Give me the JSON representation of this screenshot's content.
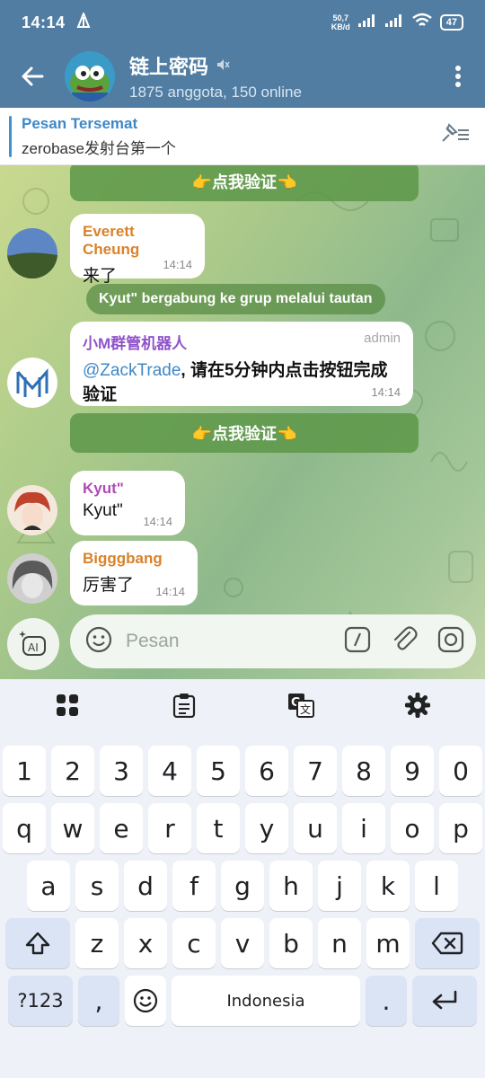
{
  "status_bar": {
    "time": "14:14",
    "net_speed": "50,7",
    "net_unit": "KB/d",
    "battery": "47"
  },
  "header": {
    "title": "链上密码",
    "subtitle": "1875 anggota, 150 online"
  },
  "pinned": {
    "title": "Pesan Tersemat",
    "text": "zerobase发射台第一个"
  },
  "messages": [
    {
      "type": "button",
      "text": "👉点我验证👈"
    },
    {
      "type": "message",
      "sender": "Everett Cheung",
      "sender_color": "#d9822b",
      "text": "来了",
      "time": "14:14"
    },
    {
      "type": "service",
      "text": "Kyut\" bergabung ke grup melalui tautan"
    },
    {
      "type": "message",
      "sender": "小M群管机器人",
      "sender_color": "#8f54c9",
      "badge": "admin",
      "mention": "@ZackTrade",
      "text": ", 请在5分钟内点击按钮完成验证",
      "time": "14:14"
    },
    {
      "type": "button",
      "text": "👉点我验证👈"
    },
    {
      "type": "message",
      "sender": "Kyut\"",
      "sender_color": "#b248b7",
      "text": "Kyut\"",
      "time": "14:14"
    },
    {
      "type": "message",
      "sender": "Bigggbang",
      "sender_color": "#d9822b",
      "text": "厉害了",
      "time": "14:14"
    }
  ],
  "input": {
    "placeholder": "Pesan"
  },
  "keyboard": {
    "row_numbers": [
      "1",
      "2",
      "3",
      "4",
      "5",
      "6",
      "7",
      "8",
      "9",
      "0"
    ],
    "row1": [
      "q",
      "w",
      "e",
      "r",
      "t",
      "y",
      "u",
      "i",
      "o",
      "p"
    ],
    "row2": [
      "a",
      "s",
      "d",
      "f",
      "g",
      "h",
      "j",
      "k",
      "l"
    ],
    "row3": [
      "z",
      "x",
      "c",
      "v",
      "b",
      "n",
      "m"
    ],
    "symbols_key": "?123",
    "comma_key": ",",
    "space_key": "Indonesia",
    "period_key": "."
  },
  "colors": {
    "header_bg": "#517da2",
    "link": "#3f88c5",
    "button_green": "#5c9648"
  }
}
